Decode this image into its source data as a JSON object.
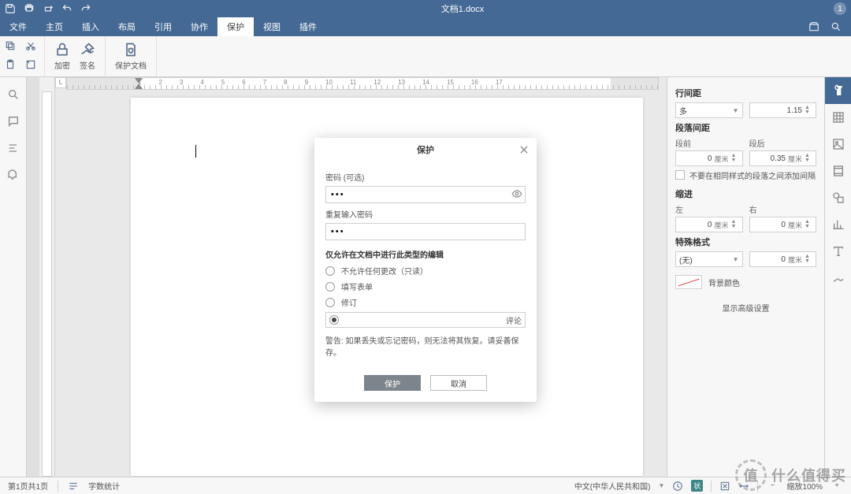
{
  "title": "文档1.docx",
  "titlebar_badge": "1",
  "menu": [
    "文件",
    "主页",
    "插入",
    "布局",
    "引用",
    "协作",
    "保护",
    "视图",
    "插件"
  ],
  "menu_active_index": 6,
  "ribbon": {
    "encrypt": "加密",
    "sign": "签名",
    "protect_doc": "保护文档"
  },
  "ruler_numbers": [
    "1",
    "",
    "1",
    "2",
    "3",
    "4",
    "5",
    "6",
    "7",
    "8",
    "9",
    "10",
    "11",
    "12",
    "13",
    "14",
    "15",
    "16",
    "17"
  ],
  "panel": {
    "line_spacing_title": "行间距",
    "line_spacing_type": "多",
    "line_spacing_value": "1.15",
    "para_spacing_title": "段落间距",
    "before_label": "段前",
    "after_label": "段后",
    "before_value": "0",
    "after_value": "0.35",
    "unit": "厘米",
    "no_space_same_style": "不要在相同样式的段落之间添加间隔",
    "indent_title": "缩进",
    "left_label": "左",
    "right_label": "右",
    "left_value": "0",
    "right_value": "0",
    "special_title": "特殊格式",
    "special_value": "(无)",
    "special_num": "0",
    "bg_color_label": "背景颜色",
    "advanced": "显示高级设置"
  },
  "status": {
    "page_info": "第1页共1页",
    "word_count": "字数统计",
    "language": "中文(中华人民共和国)",
    "track_abbr": "状",
    "zoom": "缩放100%"
  },
  "modal": {
    "title": "保护",
    "pwd_label": "密码 (可选)",
    "pwd_repeat_label": "重复输入密码",
    "section": "仅允许在文档中进行此类型的编辑",
    "opt_readonly": "不允许任何更改（只读）",
    "opt_forms": "填写表单",
    "opt_track": "修订",
    "opt_comment": "评论",
    "selected_option": 3,
    "warning": "警告: 如果丢失或忘记密码，则无法将其恢复。请妥善保存。",
    "ok": "保护",
    "cancel": "取消"
  },
  "watermark_text": "什么值得买"
}
